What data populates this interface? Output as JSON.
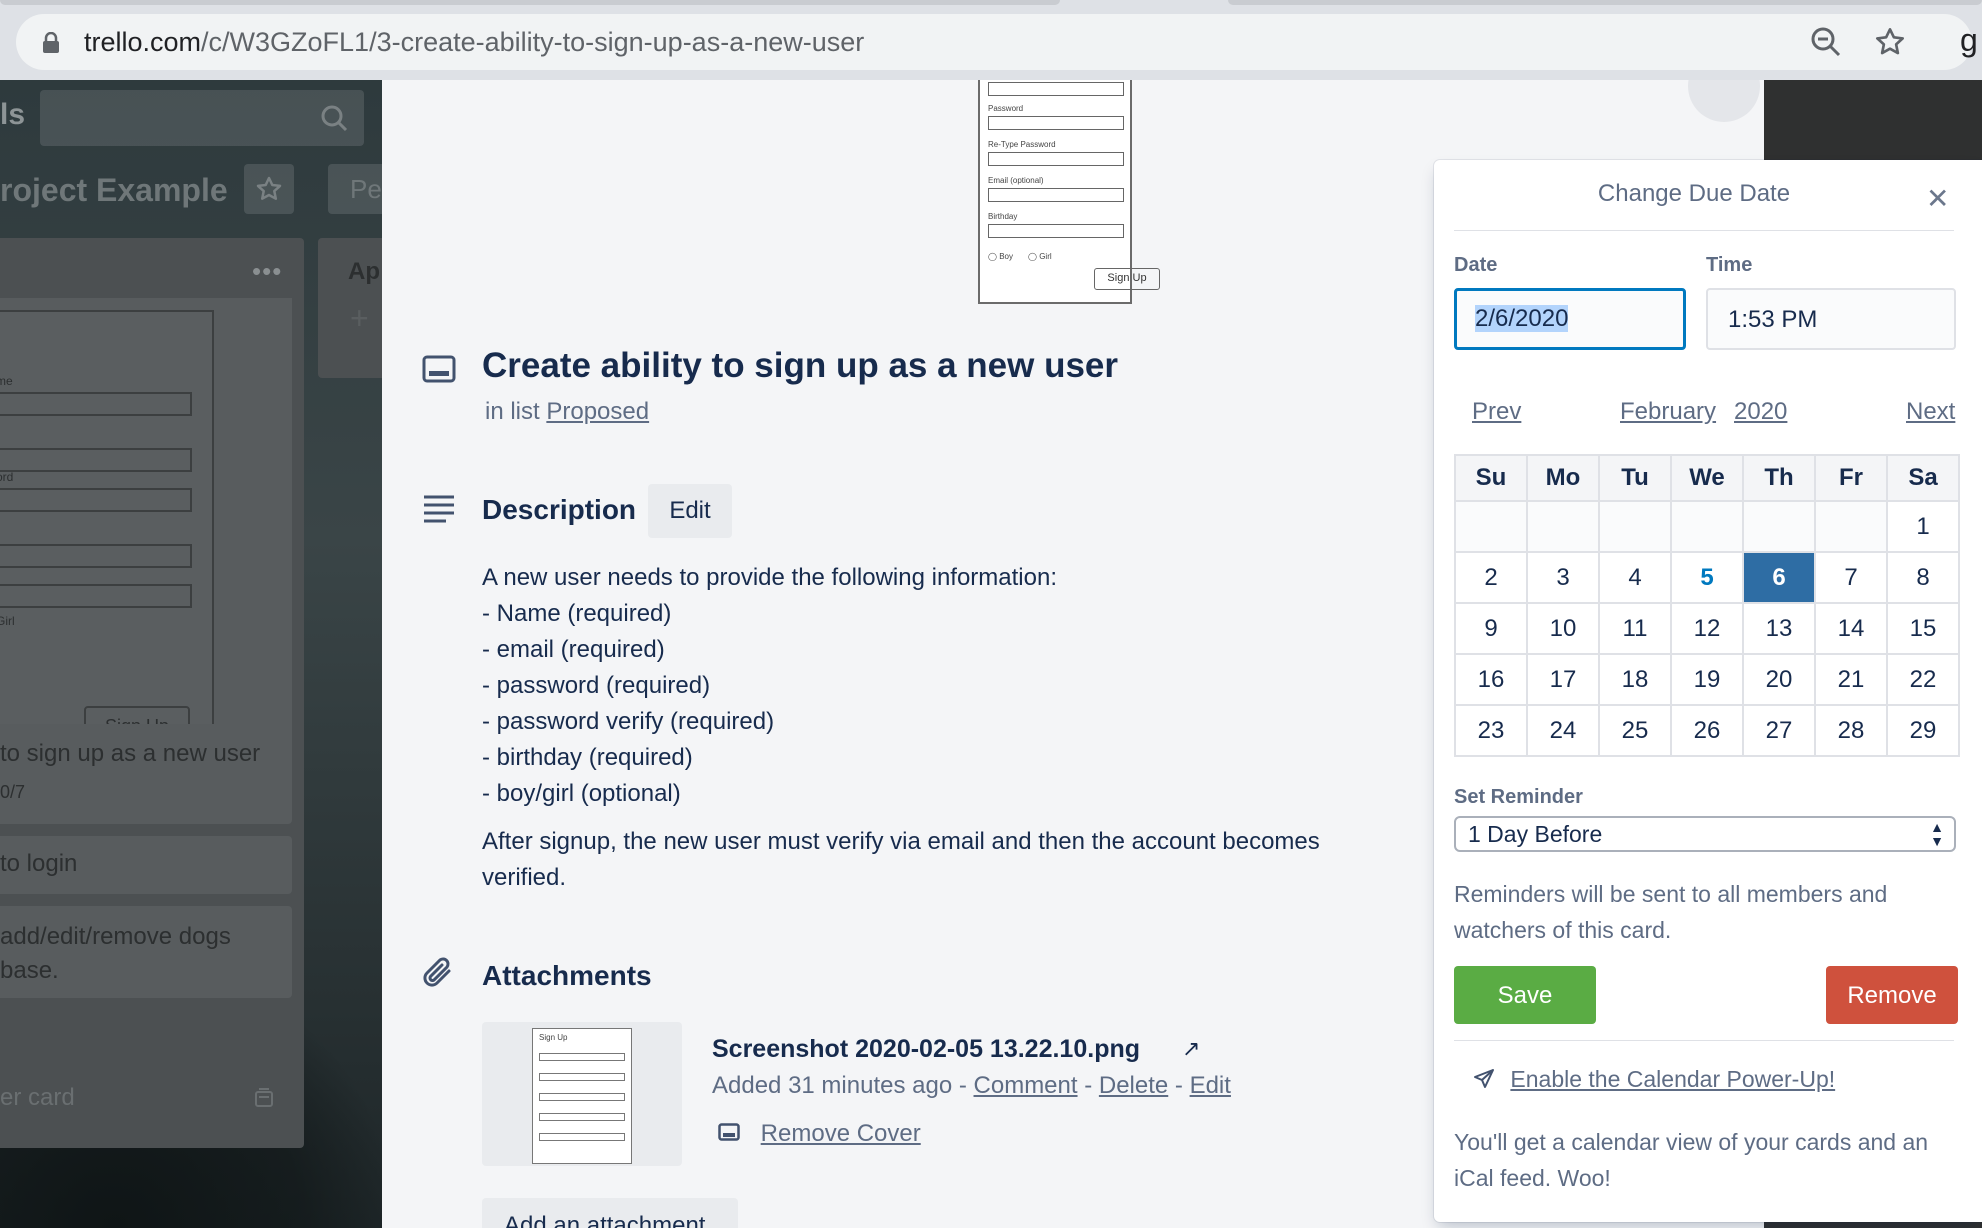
{
  "browser": {
    "url_host": "trello.com",
    "url_path": "/c/W3GZoFL1/3-create-ability-to-sign-up-as-a-new-user",
    "extension_letter": "g"
  },
  "board": {
    "left_cut_label": "ls",
    "title_fragment": "roject Example",
    "people_button": "Pe",
    "list2_title_fragment": "Ap",
    "cover_form_labels": [
      "me",
      "ord",
      "Girl"
    ],
    "cover_signup_label": "Sign Up",
    "cards": [
      {
        "text": "to sign up as a new user",
        "badge": "0/7"
      },
      {
        "text": "to login"
      },
      {
        "text": "add/edit/remove dogs",
        "line2": "base."
      }
    ],
    "add_card_fragment": "er card"
  },
  "card": {
    "cover_form": {
      "labels": [
        "Password",
        "Re-Type Password",
        "Email (optional)",
        "Birthday"
      ],
      "radio_boy": "Boy",
      "radio_girl": "Girl",
      "button": "Sign Up"
    },
    "title": "Create ability to sign up as a new user",
    "in_list_prefix": "in list",
    "list_name": "Proposed",
    "description_heading": "Description",
    "edit_label": "Edit",
    "description_lines": [
      "A new user needs to provide the following information:",
      "- Name (required)",
      "- email (required)",
      "- password (required)",
      "- password verify (required)",
      "- birthday (required)",
      "- boy/girl (optional)"
    ],
    "description_para2": "After signup, the new user must verify via email and then the account becomes verified.",
    "attachments_heading": "Attachments",
    "attachment": {
      "thumb_title": "Sign Up",
      "name": "Screenshot 2020-02-05 13.22.10.png",
      "added": "Added 31 minutes ago",
      "comment": "Comment",
      "delete": "Delete",
      "edit": "Edit",
      "remove_cover": "Remove Cover"
    },
    "add_attachment": "Add an attachment"
  },
  "due_popover": {
    "title": "Change Due Date",
    "date_label": "Date",
    "time_label": "Time",
    "date_value": "2/6/2020",
    "time_value": "1:53 PM",
    "prev": "Prev",
    "month": "February",
    "year": "2020",
    "next": "Next",
    "weekdays": [
      "Su",
      "Mo",
      "Tu",
      "We",
      "Th",
      "Fr",
      "Sa"
    ],
    "weeks": [
      [
        "",
        "",
        "",
        "",
        "",
        "",
        "1"
      ],
      [
        "2",
        "3",
        "4",
        "5",
        "6",
        "7",
        "8"
      ],
      [
        "9",
        "10",
        "11",
        "12",
        "13",
        "14",
        "15"
      ],
      [
        "16",
        "17",
        "18",
        "19",
        "20",
        "21",
        "22"
      ],
      [
        "23",
        "24",
        "25",
        "26",
        "27",
        "28",
        "29"
      ]
    ],
    "today": "5",
    "selected": "6",
    "reminder_label": "Set Reminder",
    "reminder_value": "1 Day Before",
    "reminder_note": "Reminders will be sent to all members and watchers of this card.",
    "save": "Save",
    "remove": "Remove",
    "powerup_link": "Enable the Calendar Power-Up!",
    "footer": "You'll get a calendar view of your cards and an iCal feed. Woo!"
  },
  "colors": {
    "primary_blue": "#0079bf",
    "save_green": "#5aac44",
    "remove_red": "#cf513d",
    "selected_day": "#2e6da4"
  }
}
